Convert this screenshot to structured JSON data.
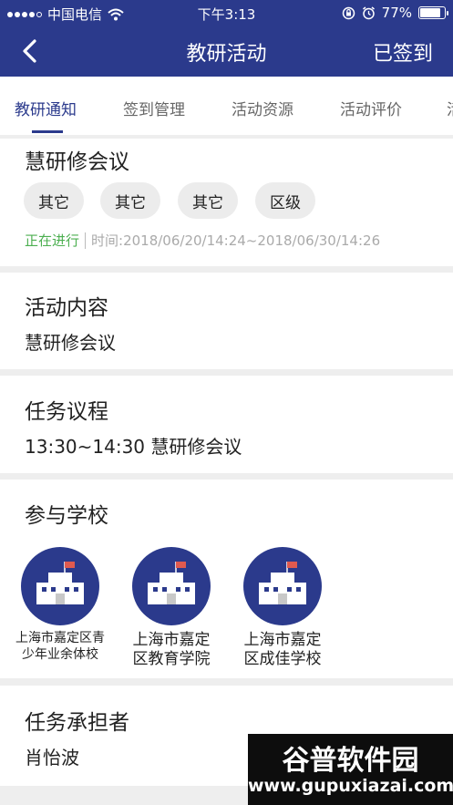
{
  "status_bar": {
    "carrier": "中国电信",
    "time": "下午3:13",
    "battery": "77%",
    "battery_level": 0.77,
    "icons": [
      "signal-icon",
      "wifi-icon",
      "rotation-lock-icon",
      "alarm-icon",
      "battery-icon"
    ]
  },
  "nav": {
    "back_icon": "back-arrow-icon",
    "title": "教研活动",
    "action": "已签到"
  },
  "tabs": [
    {
      "label": "教研通知",
      "active": true
    },
    {
      "label": "签到管理",
      "active": false
    },
    {
      "label": "活动资源",
      "active": false
    },
    {
      "label": "活动评价",
      "active": false
    },
    {
      "label": "活",
      "active": false
    }
  ],
  "activity": {
    "title": "慧研修会议",
    "tags": [
      "其它",
      "其它",
      "其它",
      "区级"
    ],
    "status": "正在进行",
    "time": "时间:2018/06/20/14:24~2018/06/30/14:26"
  },
  "content": {
    "heading": "活动内容",
    "text": "慧研修会议"
  },
  "agenda": {
    "heading": "任务议程",
    "text": "13:30~14:30 慧研修会议"
  },
  "schools": {
    "heading": "参与学校",
    "items": [
      {
        "line1": "上海市嘉定区青",
        "line2": "少年业余体校"
      },
      {
        "line1": "上海市嘉定",
        "line2": "区教育学院"
      },
      {
        "line1": "上海市嘉定",
        "line2": "区成佳学校"
      }
    ],
    "icon": "school-building-icon"
  },
  "assignee": {
    "heading": "任务承担者",
    "text": "肖怡波"
  },
  "watermark": {
    "text": "谷普软件园",
    "url": "www.gupuxiazai.com"
  },
  "colors": {
    "brand": "#2b3a8c",
    "status_green": "#4caf50",
    "chip_bg": "#ececec",
    "flag": "#e05a4f"
  }
}
